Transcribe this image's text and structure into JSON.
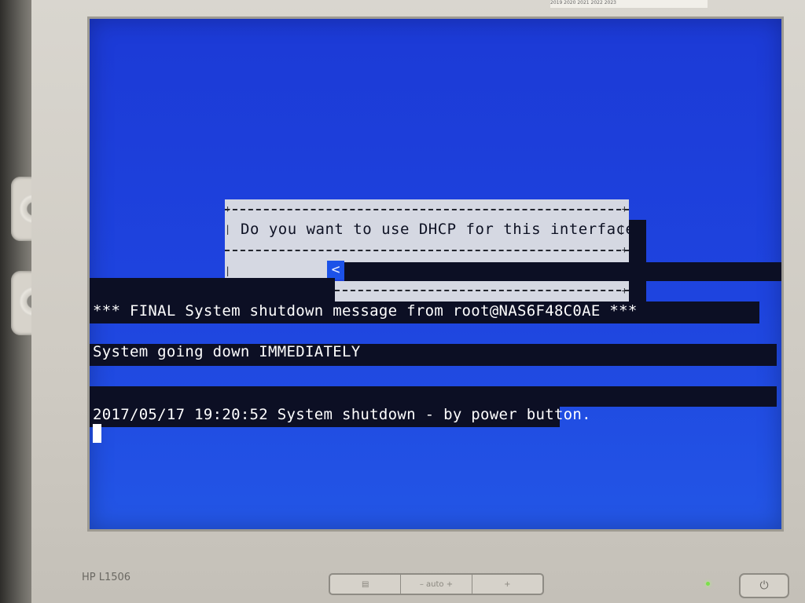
{
  "monitor": {
    "model_label": "HP L1506",
    "top_label": "2019 2020 2021 2022 2023",
    "buttons": [
      "▤",
      "– auto +",
      "+"
    ],
    "power_symbol": "⏻"
  },
  "dialog": {
    "question": "Do you want to use DHCP for this interface?",
    "left_arrow": "<",
    "corner_plus": "+",
    "side_bar": "|"
  },
  "console": {
    "line1": "*** FINAL System shutdown message from root@NAS6F48C0AE ***",
    "line2": "System going down IMMEDIATELY",
    "line3": "2017/05/17 19:20:52 System shutdown - by power button."
  },
  "colors": {
    "screen_blue": "#1e44df",
    "terminal_black": "#0c0f24",
    "dialog_gray": "#d5d8e2"
  }
}
